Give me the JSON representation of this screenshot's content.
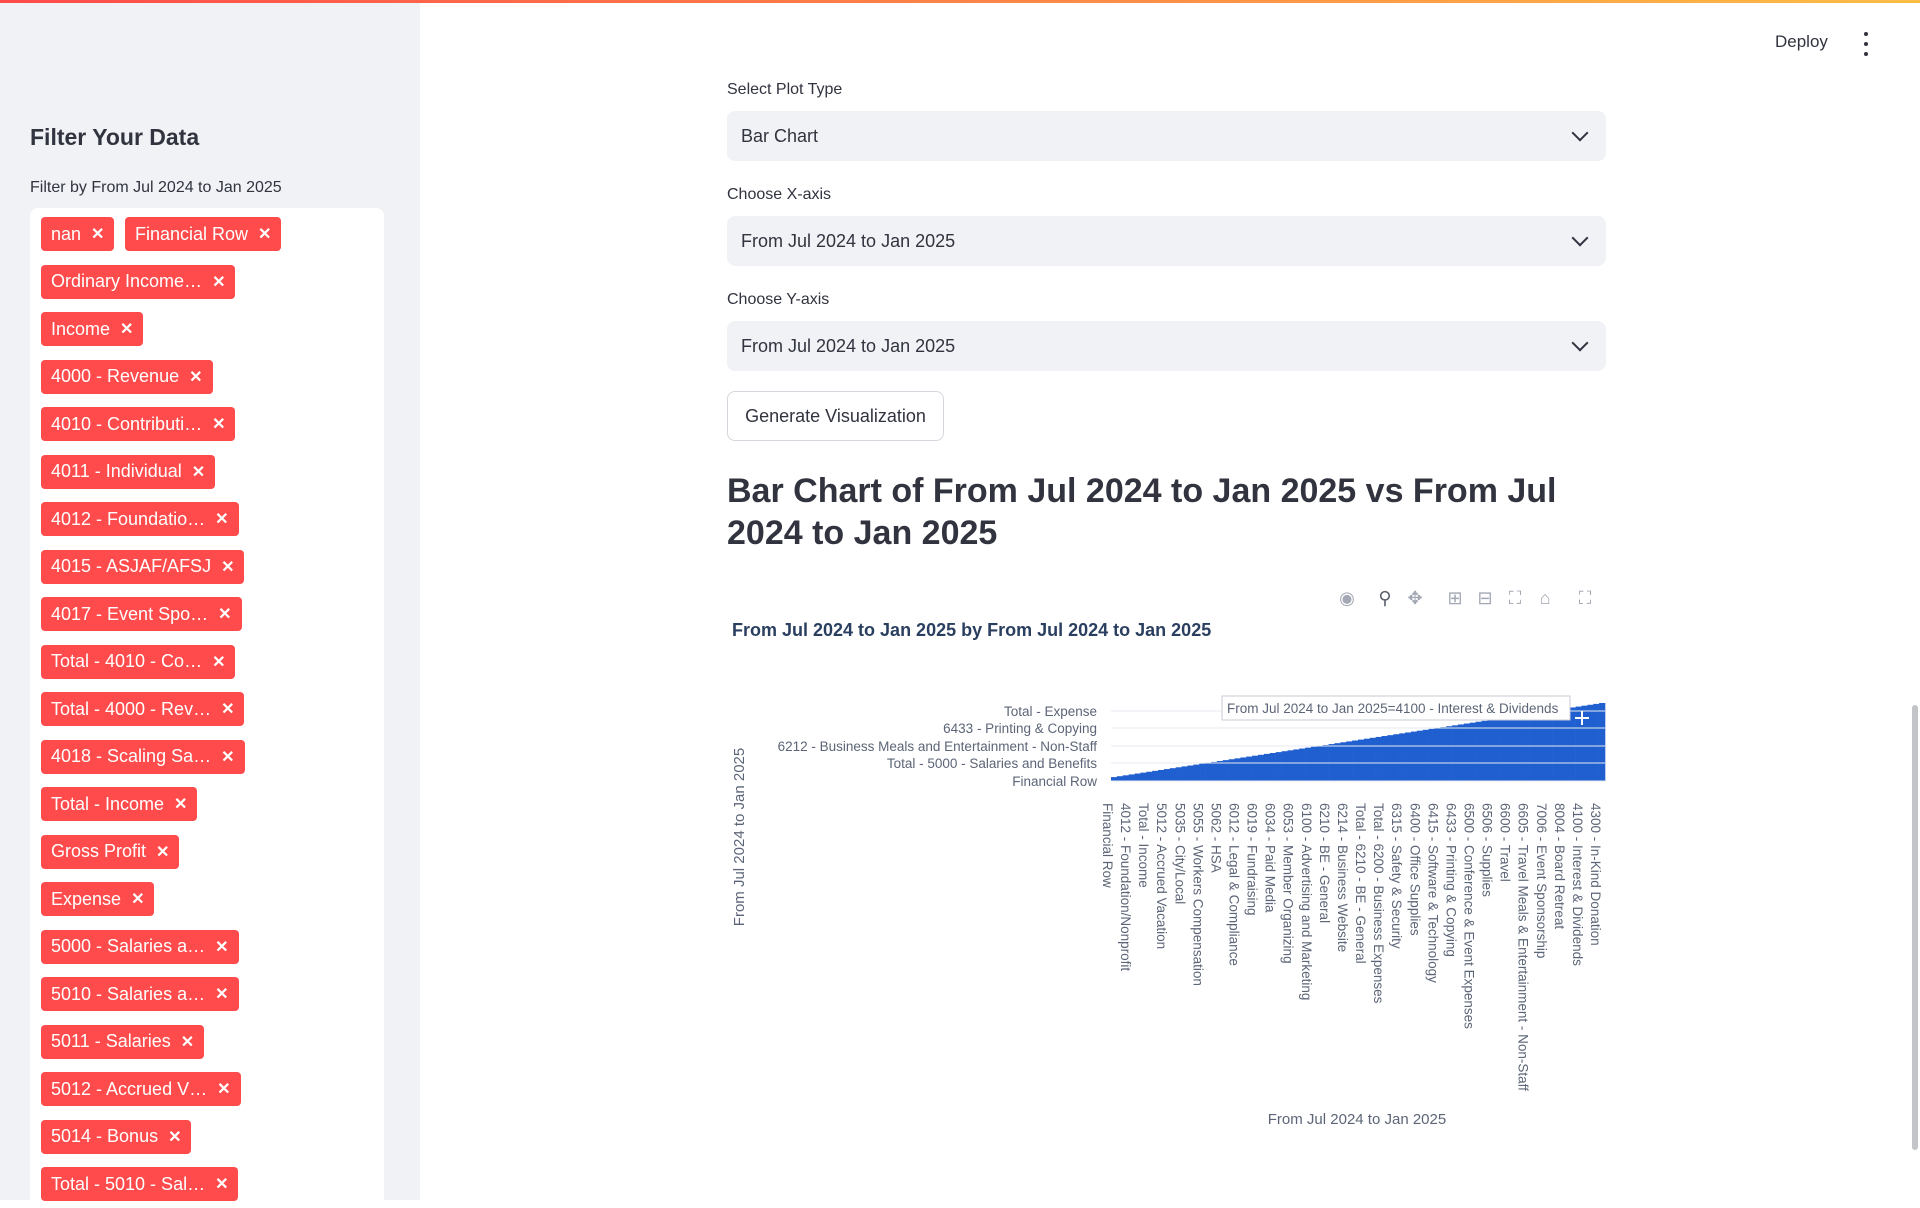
{
  "header": {
    "deploy_label": "Deploy"
  },
  "sidebar": {
    "title": "Filter Your Data",
    "filter_label": "Filter by From Jul 2024 to Jan 2025",
    "tags": [
      "nan",
      "Financial Row",
      "Ordinary Income…",
      "Income",
      "4000 - Revenue",
      "4010 - Contributi…",
      "4011 - Individual",
      "4012 - Foundatio…",
      "4015 - ASJAF/AFSJ",
      "4017 - Event Spo…",
      "Total - 4010 - Co…",
      "Total - 4000 - Rev…",
      "4018 - Scaling Sa…",
      "Total - Income",
      "Gross Profit",
      "Expense",
      "5000 - Salaries a…",
      "5010 - Salaries a…",
      "5011 - Salaries",
      "5012 - Accrued V…",
      "5014 - Bonus",
      "Total - 5010 - Sal…"
    ],
    "remove_glyph": "✕"
  },
  "controls": {
    "plot_type_label": "Select Plot Type",
    "plot_type_value": "Bar Chart",
    "x_label": "Choose X-axis",
    "x_value": "From Jul 2024 to Jan 2025",
    "y_label": "Choose Y-axis",
    "y_value": "From Jul 2024 to Jan 2025",
    "generate_label": "Generate Visualization"
  },
  "result_title": "Bar Chart of From Jul 2024 to Jan 2025 vs From Jul 2024 to Jan 2025",
  "modebar_icons": [
    "camera-icon",
    "zoom-icon",
    "pan-icon",
    "zoom-in-icon",
    "zoom-out-icon",
    "autoscale-icon",
    "reset-axes-icon",
    "fullscreen-icon"
  ],
  "chart_data": {
    "type": "bar",
    "title": "From Jul 2024 to Jan 2025 by From Jul 2024 to Jan 2025",
    "xlabel": "From Jul 2024 to Jan 2025",
    "ylabel": "From Jul 2024 to Jan 2025",
    "bar_color": "#1f5fcf",
    "y_tick_labels": [
      "Total - Expense",
      "6433 - Printing & Copying",
      "6212 - Business Meals and Entertainment -  Non-Staff",
      "Total - 5000 - Salaries and Benefits",
      "Financial Row"
    ],
    "x_tick_labels": [
      "Financial Row",
      "4012 - Foundation/Nonprofit",
      "Total - Income",
      "5012 - Accrued Vacation",
      "5035 - City/Local",
      "5055 - Workers Compensation",
      "5062 - HSA",
      "6012 - Legal & Compliance",
      "6019 - Fundraising",
      "6034 - Paid Media",
      "6053 - Member Organizing",
      "6100 - Advertising and Marketing",
      "6210 - BE - General",
      "6214 - Business Website",
      "Total - 6210 - BE - General",
      "Total - 6200 - Business Expenses",
      "6315 - Safety & Security",
      "6400 - Office Supplies",
      "6415 - Software & Technology",
      "6433 - Printing & Copying",
      "6500 - Conference & Event Expenses",
      "6506 - Supplies",
      "6600 - Travel",
      "6605 - Travel Meals & Entertainment - Non-Staff",
      "7006 - Event Sponsorship",
      "8004 - Board Retreat",
      "4100 - Interest & Dividends",
      "4300 - In-Kind Donation"
    ],
    "bar_count": 84,
    "values_note_hover": "From Jul 2024 to Jan 2025=4100 - Interest & Dividends"
  }
}
